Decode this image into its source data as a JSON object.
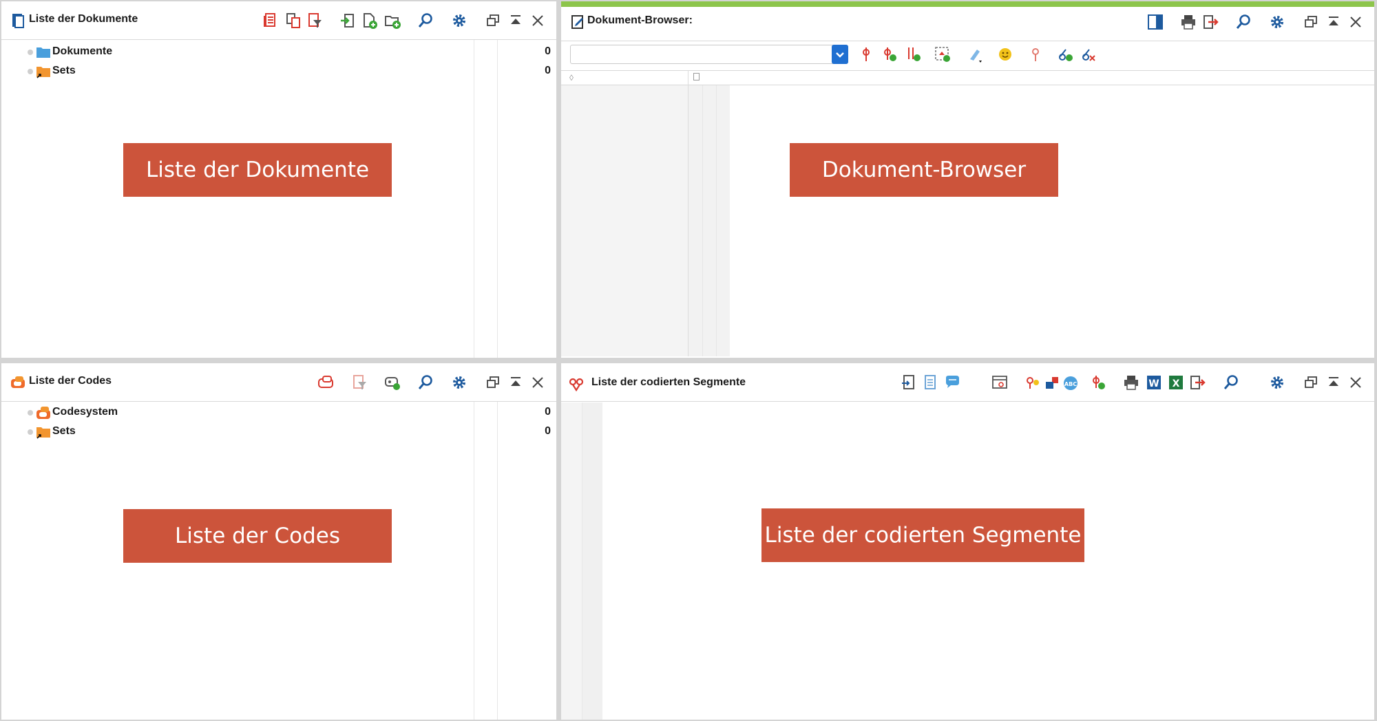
{
  "panels": {
    "documents": {
      "title": "Liste der Dokumente",
      "items": [
        {
          "label": "Dokumente",
          "count": "0"
        },
        {
          "label": "Sets",
          "count": "0"
        }
      ],
      "overlay_label": "Liste der Dokumente"
    },
    "browser": {
      "title": "Dokument-Browser:",
      "combo_value": "",
      "overlay_label": "Dokument-Browser",
      "accent_color": "#8dc54b"
    },
    "codes": {
      "title": "Liste der Codes",
      "items": [
        {
          "label": "Codesystem",
          "count": "0"
        },
        {
          "label": "Sets",
          "count": "0"
        }
      ],
      "overlay_label": "Liste der Codes"
    },
    "segments": {
      "title": "Liste der codierten Segmente",
      "overlay_label": "Liste der codierten Segmente"
    }
  },
  "colors": {
    "overlay": "#cc543b",
    "icon_blue": "#1d5a9e",
    "icon_red": "#d9392f",
    "icon_green": "#3aa536"
  }
}
